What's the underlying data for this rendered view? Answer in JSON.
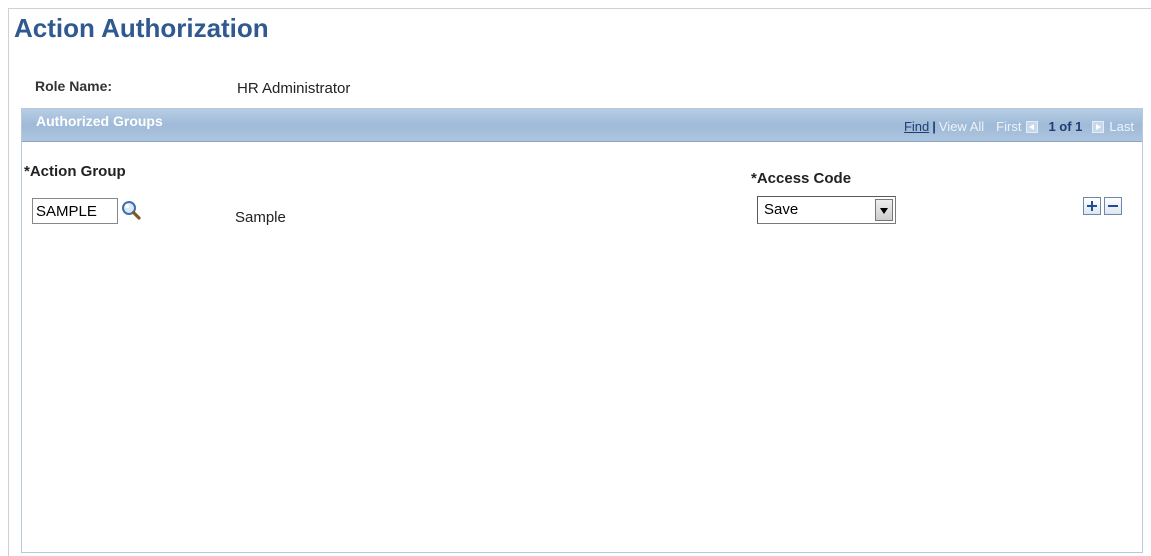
{
  "page": {
    "title": "Action Authorization"
  },
  "role": {
    "label": "Role Name:",
    "value": "HR Administrator"
  },
  "grid": {
    "title": "Authorized Groups",
    "nav": {
      "find": "Find",
      "separator": "|",
      "view_all": "View All",
      "first": "First",
      "count": "1 of 1",
      "last": "Last"
    },
    "columns": {
      "action_group": "*Action Group",
      "access_code": "*Access Code"
    },
    "row": {
      "action_group_value": "SAMPLE",
      "description": "Sample",
      "access_code_value": "Save"
    }
  },
  "icons": {
    "lookup": "magnifying-glass-icon",
    "add_row": "plus-icon",
    "delete_row": "minus-icon"
  },
  "colors": {
    "title": "#2f5990",
    "grid_header": "#a9c2de",
    "link": "#1f3e73"
  }
}
